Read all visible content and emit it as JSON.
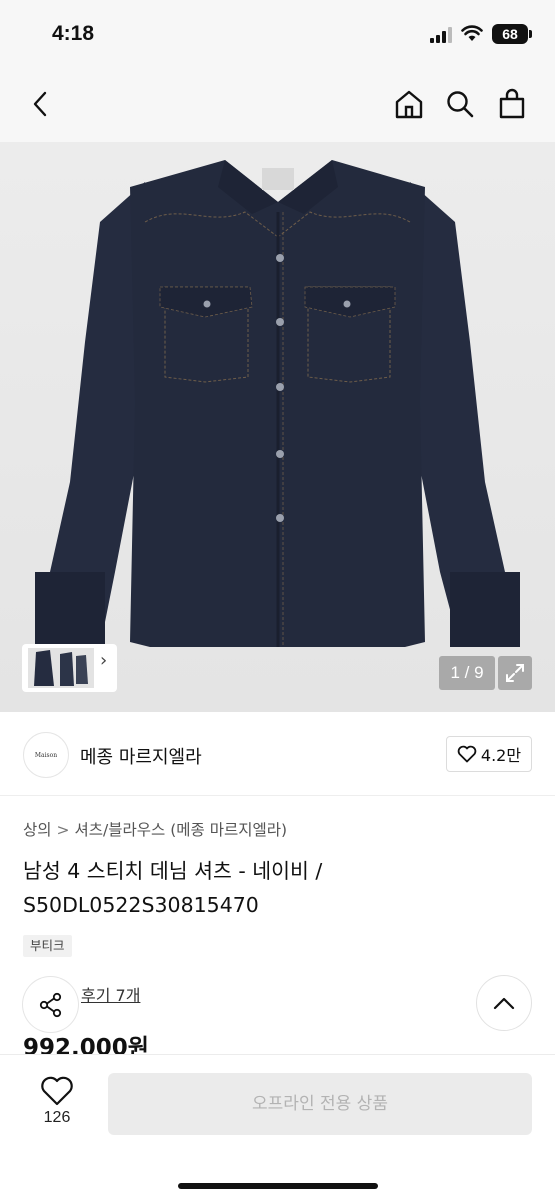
{
  "status_bar": {
    "time": "4:18",
    "battery": "68"
  },
  "nav": {
    "back_icon": "chevron-left-icon",
    "home_icon": "home-icon",
    "search_icon": "search-icon",
    "cart_icon": "shopping-bag-icon"
  },
  "gallery": {
    "counter": "1 / 9",
    "expand_icon": "expand-icon",
    "thumb_arrow": "›"
  },
  "brand": {
    "logo_text": "Maison Margiela",
    "name": "메종 마르지엘라",
    "likes": "4.2만"
  },
  "breadcrumb": {
    "category": "상의",
    "separator": ">",
    "subcategory": "셔츠/블라우스 (메종 마르지엘라)"
  },
  "product": {
    "title": "남성 4 스티치 데님 셔츠 - 네이비 / S50DL0522S30815470",
    "tag": "부티크",
    "review_link": "후기 7개",
    "price": "992,000원"
  },
  "bottom_bar": {
    "wish_count": "126",
    "buy_label": "오프라인 전용 상품"
  },
  "colors": {
    "background": "#ffffff",
    "header_bg": "#f7f7f7",
    "shirt": "#232a3d",
    "disabled_button": "#ebebeb"
  }
}
